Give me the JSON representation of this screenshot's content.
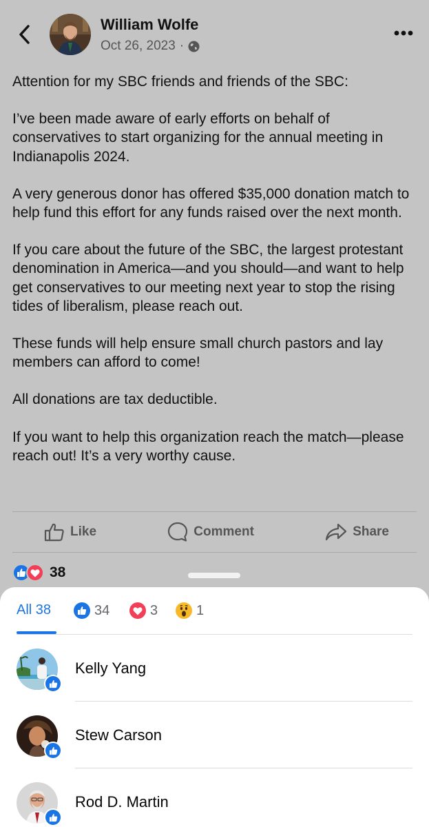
{
  "post": {
    "author_name": "William Wolfe",
    "date": "Oct 26, 2023",
    "separator": "·",
    "paragraphs": [
      "Attention for my SBC friends and friends of the SBC:",
      "I’ve been made aware of early efforts on behalf of conservatives to start organizing for the annual meeting in Indianapolis 2024.",
      "A very generous donor has offered $35,000 donation match to help fund this effort for any funds raised over the next month.",
      "If you care about the future of the SBC, the largest protestant denomination in America—and you should—and want to help get conservatives to our meeting next year to stop the rising tides of liberalism, please reach out.",
      "These funds will help ensure small church pastors and lay members can afford to come!",
      "All donations are tax deductible.",
      "If you want to help this organization reach the match—please reach out! It’s a very worthy cause."
    ],
    "actions": {
      "like": "Like",
      "comment": "Comment",
      "share": "Share"
    },
    "reaction_count": "38"
  },
  "reactions_sheet": {
    "tabs": [
      {
        "label": "All 38",
        "icon": null
      },
      {
        "label": "34",
        "icon": "like-icon"
      },
      {
        "label": "3",
        "icon": "love-icon"
      },
      {
        "label": "1",
        "icon": "wow-icon"
      }
    ],
    "people": [
      {
        "name": "Kelly Yang",
        "reaction": "like-icon"
      },
      {
        "name": "Stew Carson",
        "reaction": "like-icon"
      },
      {
        "name": "Rod D. Martin",
        "reaction": "like-icon"
      }
    ]
  },
  "colors": {
    "accent": "#1b74e4",
    "love": "#f33e58",
    "wow": "#f7b928",
    "dim_overlay": "#c4c4c4"
  }
}
